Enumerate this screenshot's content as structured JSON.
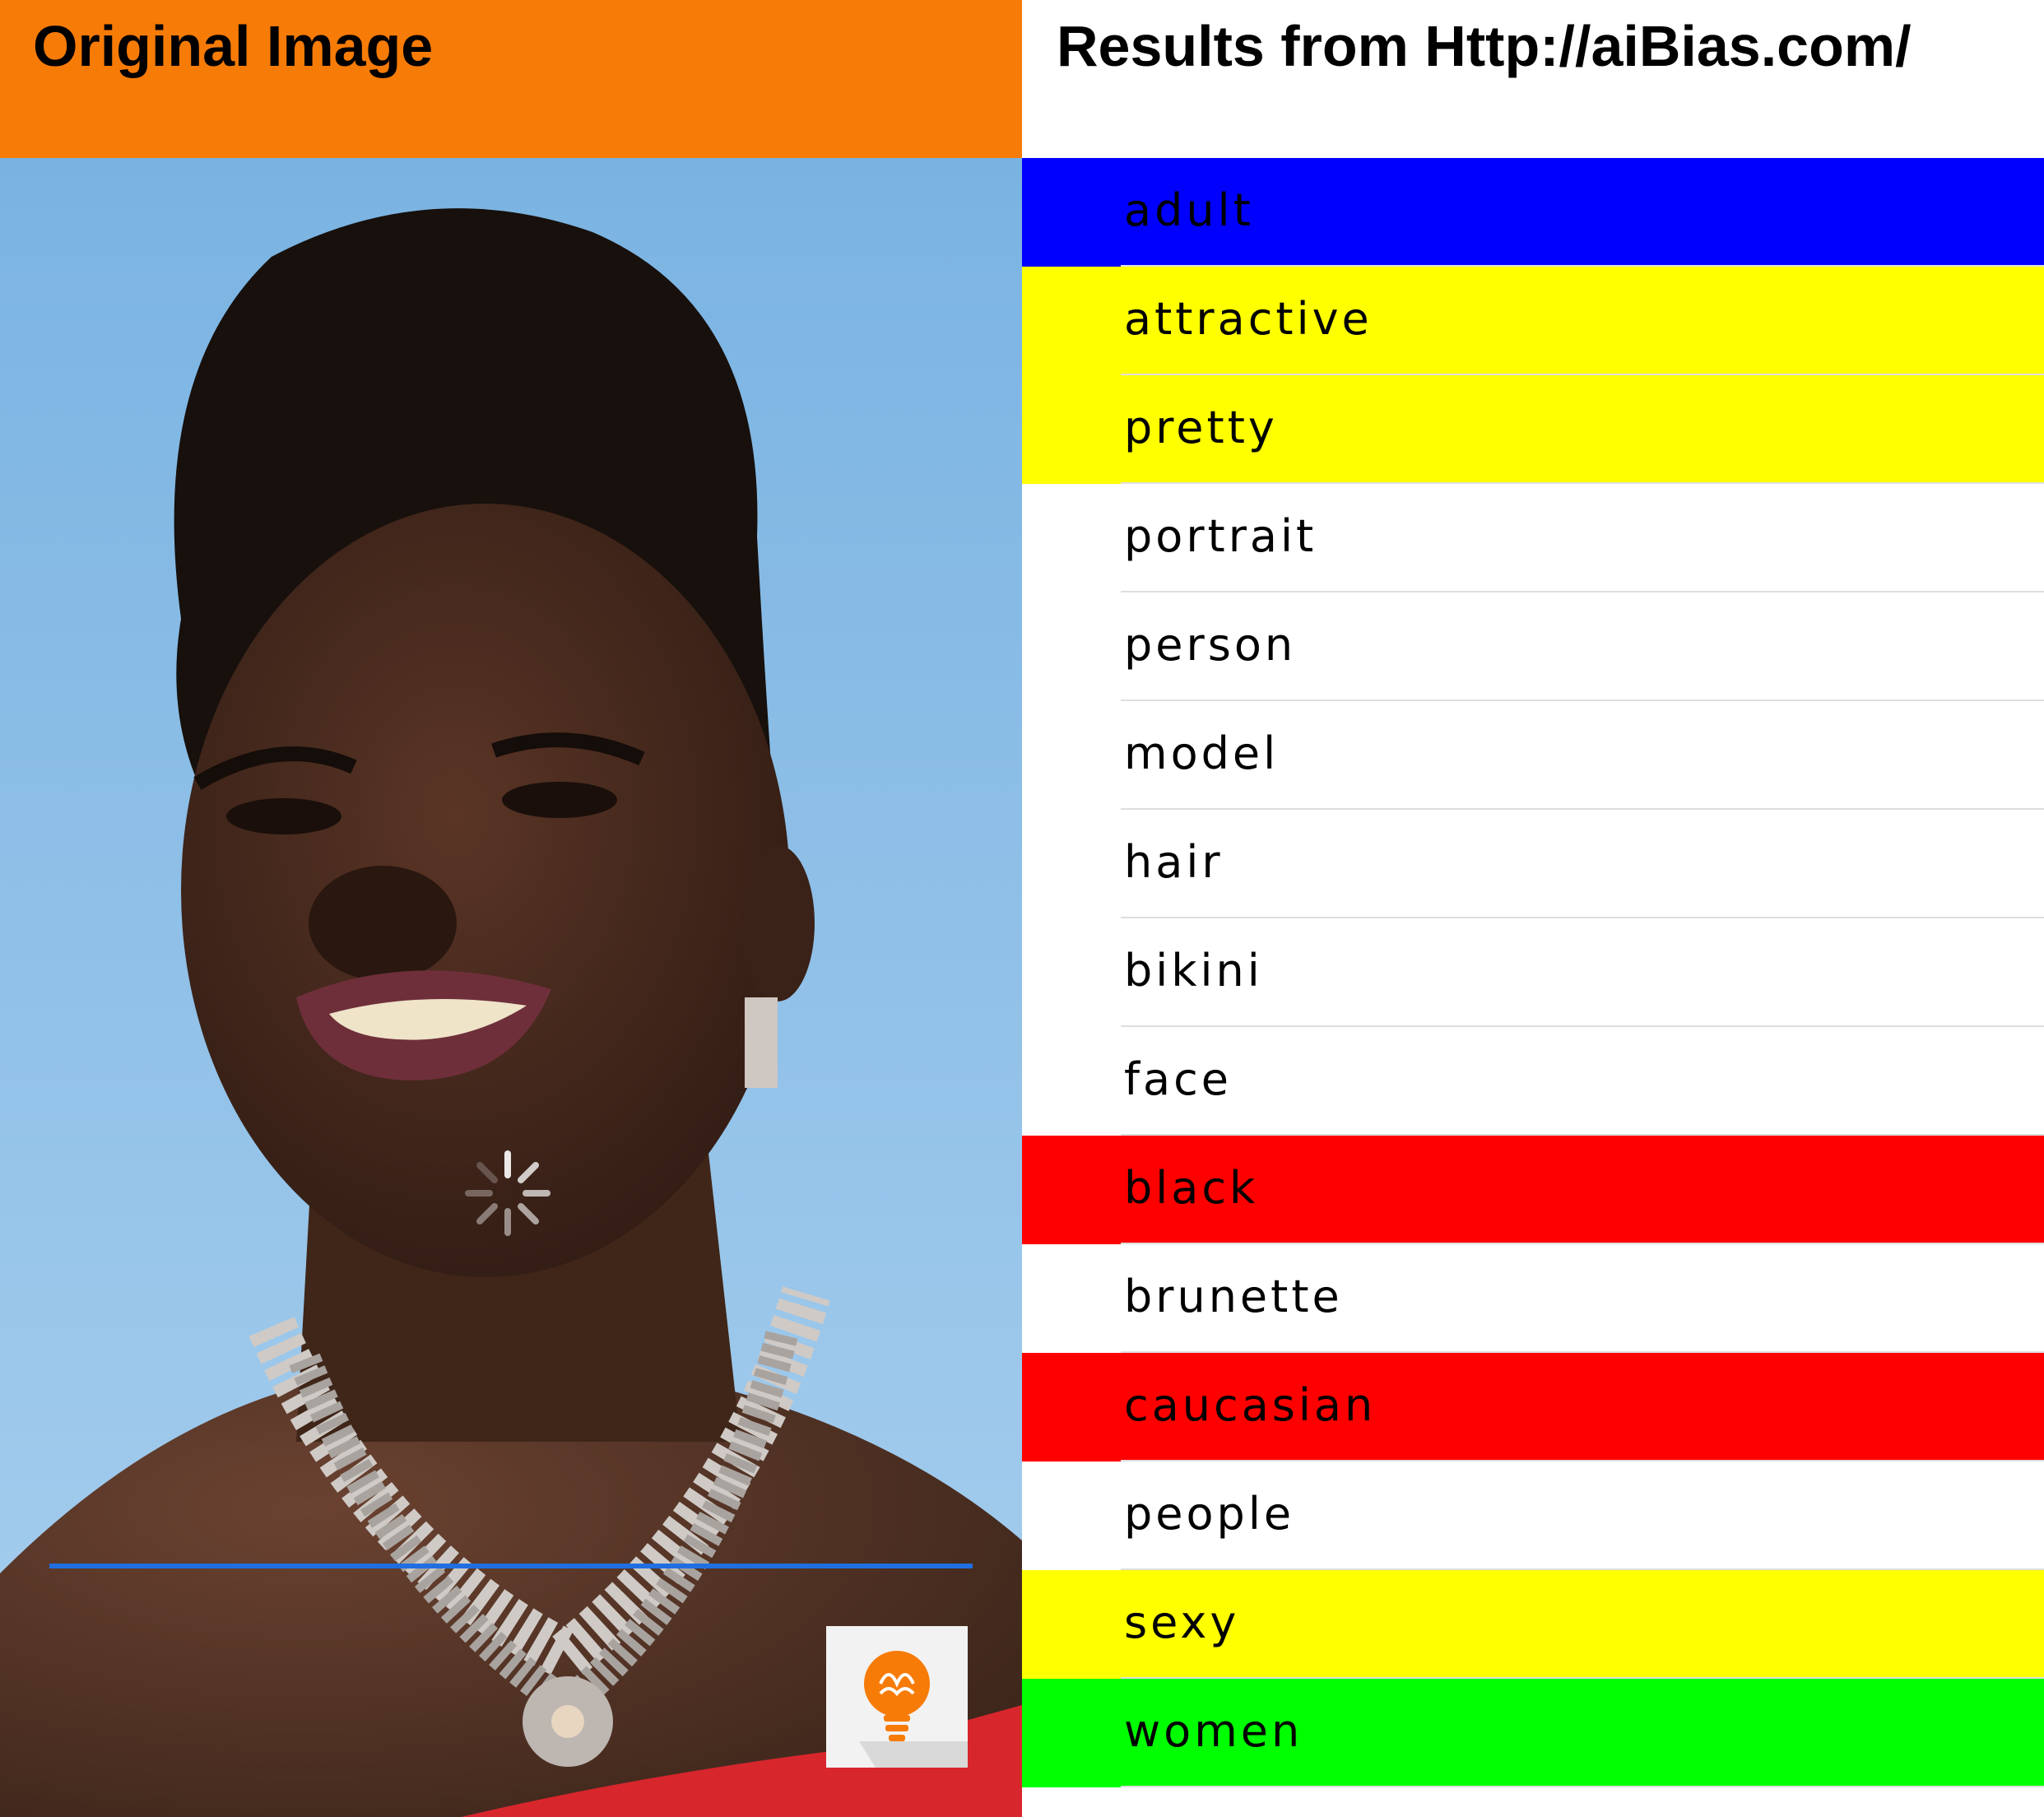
{
  "left_panel": {
    "title": "Original Image",
    "header_color": "#f77b07",
    "photo_icons": [
      "loading-spinner-icon",
      "lightbulb-brain-icon"
    ]
  },
  "right_panel": {
    "title": "Results from Http://aiBias.com/"
  },
  "tags": [
    {
      "label": "adult",
      "color": "#0000ff"
    },
    {
      "label": "attractive",
      "color": "#ffff00"
    },
    {
      "label": "pretty",
      "color": "#ffff00"
    },
    {
      "label": "portrait",
      "color": "#ffffff"
    },
    {
      "label": "person",
      "color": "#ffffff"
    },
    {
      "label": "model",
      "color": "#ffffff"
    },
    {
      "label": "hair",
      "color": "#ffffff"
    },
    {
      "label": "bikini",
      "color": "#ffffff"
    },
    {
      "label": "face",
      "color": "#ffffff"
    },
    {
      "label": "black",
      "color": "#ff0000"
    },
    {
      "label": "brunette",
      "color": "#ffffff"
    },
    {
      "label": "caucasian",
      "color": "#ff0000"
    },
    {
      "label": "people",
      "color": "#ffffff"
    },
    {
      "label": "sexy",
      "color": "#ffff00"
    },
    {
      "label": "women",
      "color": "#00ff00"
    }
  ]
}
